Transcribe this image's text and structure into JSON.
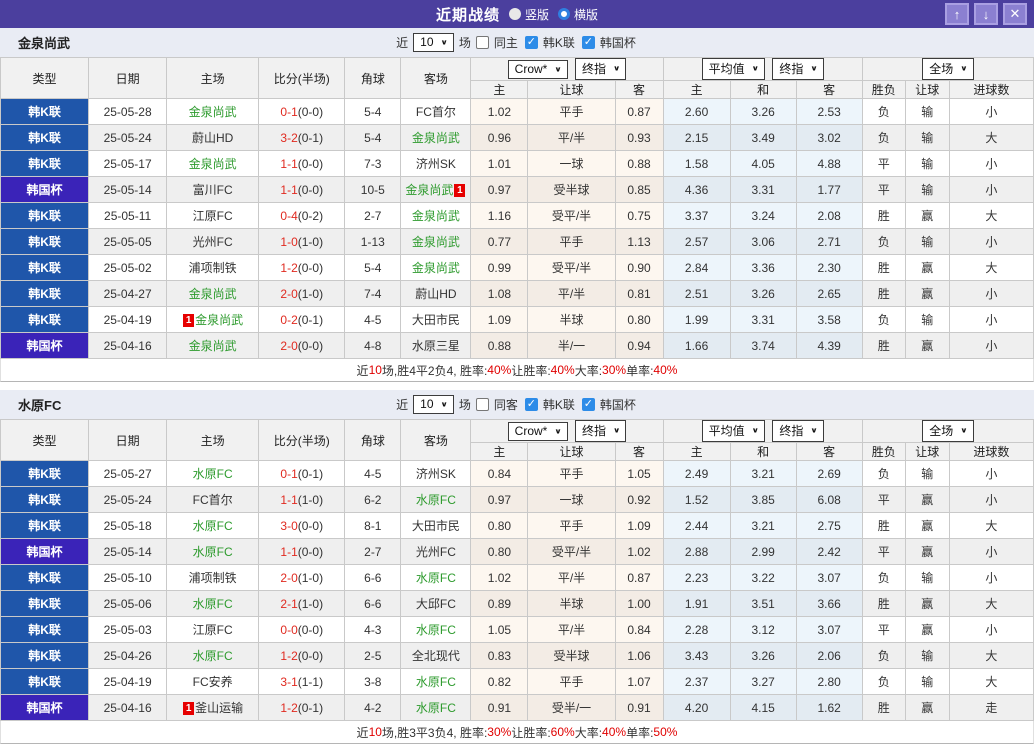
{
  "titlebar": {
    "title": "近期战绩",
    "radio_vertical_label": "竖版",
    "radio_horizontal_label": "横版",
    "bg_color": "#4b3f9e"
  },
  "icons": {
    "check": "✓",
    "up_arrow": "↑",
    "down_arrow": "↓",
    "close": "✕",
    "dropdown_arrow": "∨"
  },
  "section_controls": {
    "recent_label": "近",
    "count_value": "10",
    "matches_label": "场",
    "league_filter_1": "韩K联",
    "league_filter_2": "韩国杯"
  },
  "table_header": {
    "simple_cols": [
      "类型",
      "日期",
      "主场",
      "比分(半场)",
      "角球",
      "客场"
    ],
    "sub_cols": [
      "主",
      "让球",
      "客",
      "主",
      "和",
      "客",
      "胜负",
      "让球",
      "进球数"
    ],
    "group1": {
      "select1": "Crow*",
      "select2": "终指"
    },
    "group2": {
      "select1": "平均值",
      "select2": "终指"
    },
    "group3": {
      "select": "全场"
    }
  },
  "colors": {
    "league_type_bg": "#1f56aa",
    "cup_type_bg": "#3a23b8",
    "focal_team_green": "#2e9b2e",
    "score_red": "#e02a20",
    "result_red": "#d40000",
    "result_blue": "#2233cc",
    "result_green": "#089a08",
    "crow_col_bg": "#fdf7f0",
    "avg_col_bg": "#edf5fb",
    "checkbox_blue": "#2d8ce8"
  },
  "result_color_map": {
    "胜": "red",
    "平": "green",
    "负": "blue",
    "赢": "red",
    "输": "blue",
    "大": "red",
    "小": "blue",
    "走": "green"
  },
  "sections": [
    {
      "team": "金泉尚武",
      "same_label": "同主",
      "rows": [
        {
          "type": "韩K联",
          "cup": false,
          "date": "25-05-28",
          "home": {
            "name": "金泉尚武",
            "focal": true
          },
          "score": "0-1",
          "half": "(0-0)",
          "corner": "5-4",
          "away": {
            "name": "FC首尔",
            "focal": false
          },
          "odds": [
            "1.02",
            "平手",
            "0.87"
          ],
          "avg": [
            "2.60",
            "3.26",
            "2.53"
          ],
          "res": [
            "负",
            "输",
            "小"
          ]
        },
        {
          "type": "韩K联",
          "cup": false,
          "date": "25-05-24",
          "home": {
            "name": "蔚山HD",
            "focal": false
          },
          "score": "3-2",
          "half": "(0-1)",
          "corner": "5-4",
          "away": {
            "name": "金泉尚武",
            "focal": true
          },
          "odds": [
            "0.96",
            "平/半",
            "0.93"
          ],
          "avg": [
            "2.15",
            "3.49",
            "3.02"
          ],
          "res": [
            "负",
            "输",
            "大"
          ]
        },
        {
          "type": "韩K联",
          "cup": false,
          "date": "25-05-17",
          "home": {
            "name": "金泉尚武",
            "focal": true
          },
          "score": "1-1",
          "half": "(0-0)",
          "corner": "7-3",
          "away": {
            "name": "济州SK",
            "focal": false
          },
          "odds": [
            "1.01",
            "一球",
            "0.88"
          ],
          "avg": [
            "1.58",
            "4.05",
            "4.88"
          ],
          "res": [
            "平",
            "输",
            "小"
          ]
        },
        {
          "type": "韩国杯",
          "cup": true,
          "date": "25-05-14",
          "home": {
            "name": "富川FC",
            "focal": false
          },
          "score": "1-1",
          "half": "(0-0)",
          "corner": "10-5",
          "away": {
            "name": "金泉尚武",
            "focal": true,
            "badge": {
              "text": "1",
              "pos": "after"
            }
          },
          "odds": [
            "0.97",
            "受半球",
            "0.85"
          ],
          "avg": [
            "4.36",
            "3.31",
            "1.77"
          ],
          "res": [
            "平",
            "输",
            "小"
          ]
        },
        {
          "type": "韩K联",
          "cup": false,
          "date": "25-05-11",
          "home": {
            "name": "江原FC",
            "focal": false
          },
          "score": "0-4",
          "half": "(0-2)",
          "corner": "2-7",
          "away": {
            "name": "金泉尚武",
            "focal": true
          },
          "odds": [
            "1.16",
            "受平/半",
            "0.75"
          ],
          "avg": [
            "3.37",
            "3.24",
            "2.08"
          ],
          "res": [
            "胜",
            "赢",
            "大"
          ]
        },
        {
          "type": "韩K联",
          "cup": false,
          "date": "25-05-05",
          "home": {
            "name": "光州FC",
            "focal": false
          },
          "score": "1-0",
          "half": "(1-0)",
          "corner": "1-13",
          "away": {
            "name": "金泉尚武",
            "focal": true
          },
          "odds": [
            "0.77",
            "平手",
            "1.13"
          ],
          "avg": [
            "2.57",
            "3.06",
            "2.71"
          ],
          "res": [
            "负",
            "输",
            "小"
          ]
        },
        {
          "type": "韩K联",
          "cup": false,
          "date": "25-05-02",
          "home": {
            "name": "浦项制铁",
            "focal": false
          },
          "score": "1-2",
          "half": "(0-0)",
          "corner": "5-4",
          "away": {
            "name": "金泉尚武",
            "focal": true
          },
          "odds": [
            "0.99",
            "受平/半",
            "0.90"
          ],
          "avg": [
            "2.84",
            "3.36",
            "2.30"
          ],
          "res": [
            "胜",
            "赢",
            "大"
          ]
        },
        {
          "type": "韩K联",
          "cup": false,
          "date": "25-04-27",
          "home": {
            "name": "金泉尚武",
            "focal": true
          },
          "score": "2-0",
          "half": "(1-0)",
          "corner": "7-4",
          "away": {
            "name": "蔚山HD",
            "focal": false
          },
          "odds": [
            "1.08",
            "平/半",
            "0.81"
          ],
          "avg": [
            "2.51",
            "3.26",
            "2.65"
          ],
          "res": [
            "胜",
            "赢",
            "小"
          ]
        },
        {
          "type": "韩K联",
          "cup": false,
          "date": "25-04-19",
          "home": {
            "name": "金泉尚武",
            "focal": true,
            "badge": {
              "text": "1",
              "pos": "before"
            }
          },
          "score": "0-2",
          "half": "(0-1)",
          "corner": "4-5",
          "away": {
            "name": "大田市民",
            "focal": false
          },
          "odds": [
            "1.09",
            "半球",
            "0.80"
          ],
          "avg": [
            "1.99",
            "3.31",
            "3.58"
          ],
          "res": [
            "负",
            "输",
            "小"
          ]
        },
        {
          "type": "韩国杯",
          "cup": true,
          "date": "25-04-16",
          "home": {
            "name": "金泉尚武",
            "focal": true
          },
          "score": "2-0",
          "half": "(0-0)",
          "corner": "4-8",
          "away": {
            "name": "水原三星",
            "focal": false
          },
          "odds": [
            "0.88",
            "半/一",
            "0.94"
          ],
          "avg": [
            "1.66",
            "3.74",
            "4.39"
          ],
          "res": [
            "胜",
            "赢",
            "小"
          ]
        }
      ],
      "summary": [
        {
          "t": "近"
        },
        {
          "t": "10",
          "c": "red"
        },
        {
          "t": "场,胜4平2负4, 胜率:"
        },
        {
          "t": "40%",
          "c": "red"
        },
        {
          "t": " 让胜率:"
        },
        {
          "t": "40%",
          "c": "red"
        },
        {
          "t": " 大率:"
        },
        {
          "t": "30%",
          "c": "red"
        },
        {
          "t": " 单率:"
        },
        {
          "t": "40%",
          "c": "red"
        }
      ]
    },
    {
      "team": "水原FC",
      "same_label": "同客",
      "rows": [
        {
          "type": "韩K联",
          "cup": false,
          "date": "25-05-27",
          "home": {
            "name": "水原FC",
            "focal": true
          },
          "score": "0-1",
          "half": "(0-1)",
          "corner": "4-5",
          "away": {
            "name": "济州SK",
            "focal": false
          },
          "odds": [
            "0.84",
            "平手",
            "1.05"
          ],
          "avg": [
            "2.49",
            "3.21",
            "2.69"
          ],
          "res": [
            "负",
            "输",
            "小"
          ]
        },
        {
          "type": "韩K联",
          "cup": false,
          "date": "25-05-24",
          "home": {
            "name": "FC首尔",
            "focal": false
          },
          "score": "1-1",
          "half": "(1-0)",
          "corner": "6-2",
          "away": {
            "name": "水原FC",
            "focal": true
          },
          "odds": [
            "0.97",
            "一球",
            "0.92"
          ],
          "avg": [
            "1.52",
            "3.85",
            "6.08"
          ],
          "res": [
            "平",
            "赢",
            "小"
          ]
        },
        {
          "type": "韩K联",
          "cup": false,
          "date": "25-05-18",
          "home": {
            "name": "水原FC",
            "focal": true
          },
          "score": "3-0",
          "half": "(0-0)",
          "corner": "8-1",
          "away": {
            "name": "大田市民",
            "focal": false
          },
          "odds": [
            "0.80",
            "平手",
            "1.09"
          ],
          "avg": [
            "2.44",
            "3.21",
            "2.75"
          ],
          "res": [
            "胜",
            "赢",
            "大"
          ]
        },
        {
          "type": "韩国杯",
          "cup": true,
          "date": "25-05-14",
          "home": {
            "name": "水原FC",
            "focal": true
          },
          "score": "1-1",
          "half": "(0-0)",
          "corner": "2-7",
          "away": {
            "name": "光州FC",
            "focal": false
          },
          "odds": [
            "0.80",
            "受平/半",
            "1.02"
          ],
          "avg": [
            "2.88",
            "2.99",
            "2.42"
          ],
          "res": [
            "平",
            "赢",
            "小"
          ]
        },
        {
          "type": "韩K联",
          "cup": false,
          "date": "25-05-10",
          "home": {
            "name": "浦项制铁",
            "focal": false
          },
          "score": "2-0",
          "half": "(1-0)",
          "corner": "6-6",
          "away": {
            "name": "水原FC",
            "focal": true
          },
          "odds": [
            "1.02",
            "平/半",
            "0.87"
          ],
          "avg": [
            "2.23",
            "3.22",
            "3.07"
          ],
          "res": [
            "负",
            "输",
            "小"
          ]
        },
        {
          "type": "韩K联",
          "cup": false,
          "date": "25-05-06",
          "home": {
            "name": "水原FC",
            "focal": true
          },
          "score": "2-1",
          "half": "(1-0)",
          "corner": "6-6",
          "away": {
            "name": "大邱FC",
            "focal": false
          },
          "odds": [
            "0.89",
            "半球",
            "1.00"
          ],
          "avg": [
            "1.91",
            "3.51",
            "3.66"
          ],
          "res": [
            "胜",
            "赢",
            "大"
          ]
        },
        {
          "type": "韩K联",
          "cup": false,
          "date": "25-05-03",
          "home": {
            "name": "江原FC",
            "focal": false
          },
          "score": "0-0",
          "half": "(0-0)",
          "corner": "4-3",
          "away": {
            "name": "水原FC",
            "focal": true
          },
          "odds": [
            "1.05",
            "平/半",
            "0.84"
          ],
          "avg": [
            "2.28",
            "3.12",
            "3.07"
          ],
          "res": [
            "平",
            "赢",
            "小"
          ]
        },
        {
          "type": "韩K联",
          "cup": false,
          "date": "25-04-26",
          "home": {
            "name": "水原FC",
            "focal": true
          },
          "score": "1-2",
          "half": "(0-0)",
          "corner": "2-5",
          "away": {
            "name": "全北现代",
            "focal": false
          },
          "odds": [
            "0.83",
            "受半球",
            "1.06"
          ],
          "avg": [
            "3.43",
            "3.26",
            "2.06"
          ],
          "res": [
            "负",
            "输",
            "大"
          ]
        },
        {
          "type": "韩K联",
          "cup": false,
          "date": "25-04-19",
          "home": {
            "name": "FC安养",
            "focal": false
          },
          "score": "3-1",
          "half": "(1-1)",
          "corner": "3-8",
          "away": {
            "name": "水原FC",
            "focal": true
          },
          "odds": [
            "0.82",
            "平手",
            "1.07"
          ],
          "avg": [
            "2.37",
            "3.27",
            "2.80"
          ],
          "res": [
            "负",
            "输",
            "大"
          ]
        },
        {
          "type": "韩国杯",
          "cup": true,
          "date": "25-04-16",
          "home": {
            "name": "釜山运输",
            "focal": false,
            "badge": {
              "text": "1",
              "pos": "before"
            }
          },
          "score": "1-2",
          "half": "(0-1)",
          "corner": "4-2",
          "away": {
            "name": "水原FC",
            "focal": true
          },
          "odds": [
            "0.91",
            "受半/一",
            "0.91"
          ],
          "avg": [
            "4.20",
            "4.15",
            "1.62"
          ],
          "res": [
            "胜",
            "赢",
            "走"
          ]
        }
      ],
      "summary": [
        {
          "t": "近"
        },
        {
          "t": "10",
          "c": "red"
        },
        {
          "t": "场,胜3平3负4, 胜率:"
        },
        {
          "t": "30%",
          "c": "red"
        },
        {
          "t": " 让胜率:"
        },
        {
          "t": "60%",
          "c": "red"
        },
        {
          "t": " 大率:"
        },
        {
          "t": "40%",
          "c": "red"
        },
        {
          "t": " 单率:"
        },
        {
          "t": "50%",
          "c": "red"
        }
      ]
    }
  ]
}
